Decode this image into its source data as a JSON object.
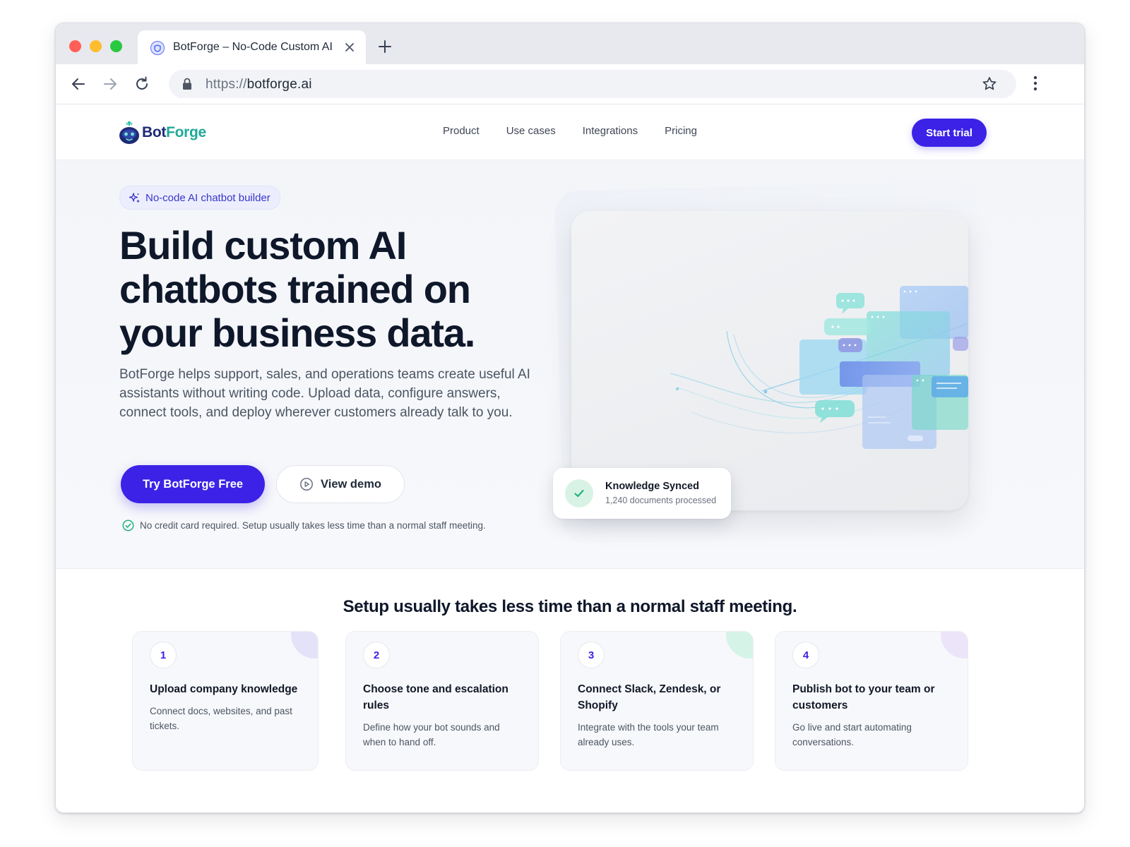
{
  "browser": {
    "tab_title": "BotForge – No-Code Custom AI",
    "url_scheme": "https://",
    "url_host": "botforge.ai"
  },
  "header": {
    "logo_part1": "Bot",
    "logo_part2": "Forge",
    "nav": [
      "Product",
      "Use cases",
      "Integrations",
      "Pricing"
    ],
    "cta": "Start trial"
  },
  "hero": {
    "badge": "No-code AI chatbot builder",
    "title": "Build custom AI chatbots trained on your business data.",
    "subtitle": "BotForge helps support, sales, and operations teams create useful AI assistants without writing code. Upload data, configure answers, connect tools, and deploy wherever customers already talk to you.",
    "primary_cta": "Try BotForge Free",
    "secondary_cta": "View demo",
    "reassurance": "No credit card required. Setup usually takes less time than a normal staff meeting.",
    "toast": {
      "title": "Knowledge Synced",
      "subtitle": "1,240 documents processed"
    }
  },
  "steps": {
    "title": "Setup usually takes less time than a normal staff meeting.",
    "items": [
      {
        "number": "1",
        "title": "Upload company knowledge",
        "description": "Connect docs, websites, and past tickets."
      },
      {
        "number": "2",
        "title": "Choose tone and escalation rules",
        "description": "Define how your bot sounds and when to hand off."
      },
      {
        "number": "3",
        "title": "Connect Slack, Zendesk, or Shopify",
        "description": "Integrate with the tools your team already uses."
      },
      {
        "number": "4",
        "title": "Publish bot to your team or customers",
        "description": "Go live and start automating conversations."
      }
    ]
  },
  "colors": {
    "brand_primary": "#3b22e6",
    "brand_teal": "#1fa99a",
    "success": "#22b07d"
  },
  "icons": {
    "tab_favicon": "shield-icon",
    "badge": "sparkle-icon",
    "demo": "play-circle-icon",
    "reassurance": "check-circle-icon",
    "toast": "check-icon"
  }
}
